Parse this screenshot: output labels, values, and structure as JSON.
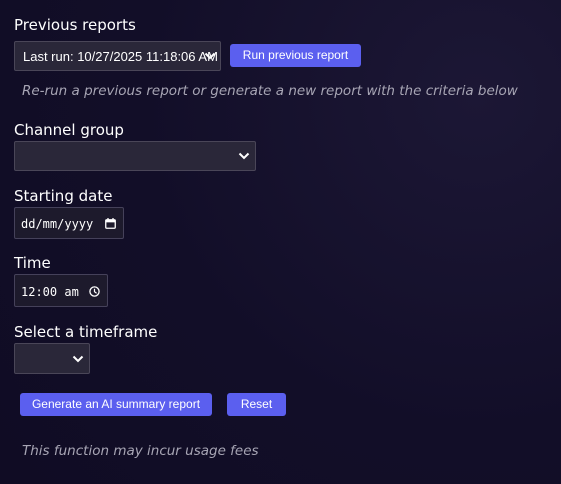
{
  "previous_reports": {
    "heading": "Previous reports",
    "selected": "Last run: 10/27/2025 11:18:06 AM",
    "run_button": "Run previous report",
    "hint": "Re-run a previous report or generate a new report with the criteria below"
  },
  "channel_group": {
    "label": "Channel group",
    "selected": ""
  },
  "starting_date": {
    "label": "Starting date",
    "placeholder": "dd/mm/yyyy"
  },
  "time": {
    "label": "Time",
    "value": "12:00 am"
  },
  "timeframe": {
    "label": "Select a timeframe",
    "selected": ""
  },
  "actions": {
    "generate_button": "Generate an AI summary report",
    "reset_button": "Reset"
  },
  "footer_note": "This function may incur usage fees",
  "colors": {
    "accent": "#5b5fef",
    "background": "#100c24",
    "muted_text": "#a7a5b4"
  }
}
